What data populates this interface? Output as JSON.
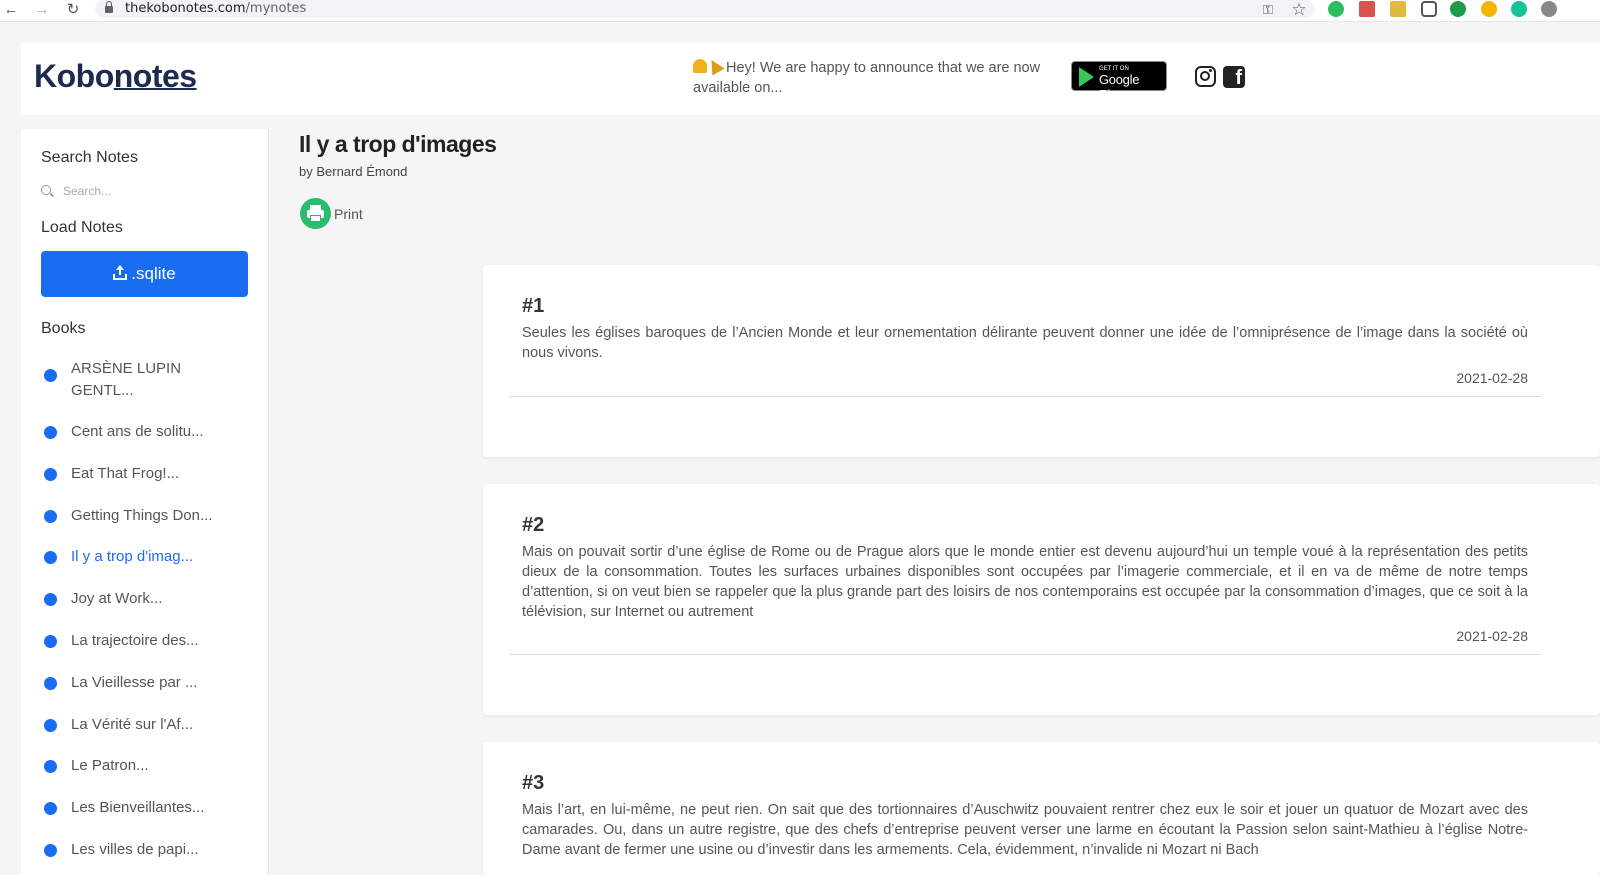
{
  "browser": {
    "url_domain": "thekobonotes.com",
    "url_path": "/mynotes",
    "back_glyph": "←",
    "forward_glyph": "→",
    "reload_glyph": "↻",
    "key_glyph": "⚿",
    "star_glyph": "☆"
  },
  "header": {
    "logo_prefix": "Kobo",
    "logo_suffix": "notes",
    "announcement": "Hey! We are happy to announce that we are now available on...",
    "google_play_small": "GET IT ON",
    "google_play_big": "Google Play",
    "facebook_glyph": "f"
  },
  "sidebar": {
    "search_heading": "Search Notes",
    "search_placeholder": "Search...",
    "load_heading": "Load Notes",
    "upload_label": ".sqlite",
    "books_heading": "Books",
    "books": [
      {
        "label": "ARSÈNE LUPIN GENTL...",
        "active": false
      },
      {
        "label": "Cent ans de solitu...",
        "active": false
      },
      {
        "label": "Eat That Frog!...",
        "active": false
      },
      {
        "label": "Getting Things Don...",
        "active": false
      },
      {
        "label": "Il y a trop d'imag...",
        "active": true
      },
      {
        "label": "Joy at Work...",
        "active": false
      },
      {
        "label": "La trajectoire des...",
        "active": false
      },
      {
        "label": "La Vieillesse par ...",
        "active": false
      },
      {
        "label": "La Vérité sur l'Af...",
        "active": false
      },
      {
        "label": "Le Patron...",
        "active": false
      },
      {
        "label": "Les Bienveillantes...",
        "active": false
      },
      {
        "label": "Les villes de papi...",
        "active": false
      }
    ]
  },
  "main": {
    "title": "Il y a trop d'images",
    "author": "by Bernard Émond",
    "print_label": "Print",
    "notes": [
      {
        "number": "#1",
        "text": "Seules les églises baroques de l’Ancien Monde et leur ornementation délirante peuvent donner une idée de l’omniprésence de l’image dans la société où nous vivons.",
        "date": "2021-02-28"
      },
      {
        "number": "#2",
        "text": "Mais on pouvait sortir d’une église de Rome ou de Prague alors que le monde entier est devenu aujourd’hui un temple voué à la représentation des petits dieux de la consommation. Toutes les surfaces urbaines disponibles sont occupées par l’imagerie commerciale, et il en va de même de notre temps d’attention, si on veut bien se rappeler que la plus grande part des loisirs de nos contemporains est occupée par la consommation d’images, que ce soit à la télévision, sur Internet ou autrement",
        "date": "2021-02-28"
      },
      {
        "number": "#3",
        "text": "Mais l’art, en lui-même, ne peut rien. On sait que des tortionnaires d’Auschwitz pouvaient rentrer chez eux le soir et jouer un quatuor de Mozart avec des camarades. Ou, dans un autre registre, que des chefs d’entreprise peuvent verser une larme en écoutant la Passion selon saint-Mathieu à l’église Notre-Dame avant de fermer une usine ou d’investir dans les armements. Cela, évidemment, n’invalide ni Mozart ni Bach",
        "date": ""
      }
    ]
  },
  "colors": {
    "accent": "#1a6cf0",
    "print_green": "#2bbd6e",
    "logo": "#1d2b4f"
  }
}
